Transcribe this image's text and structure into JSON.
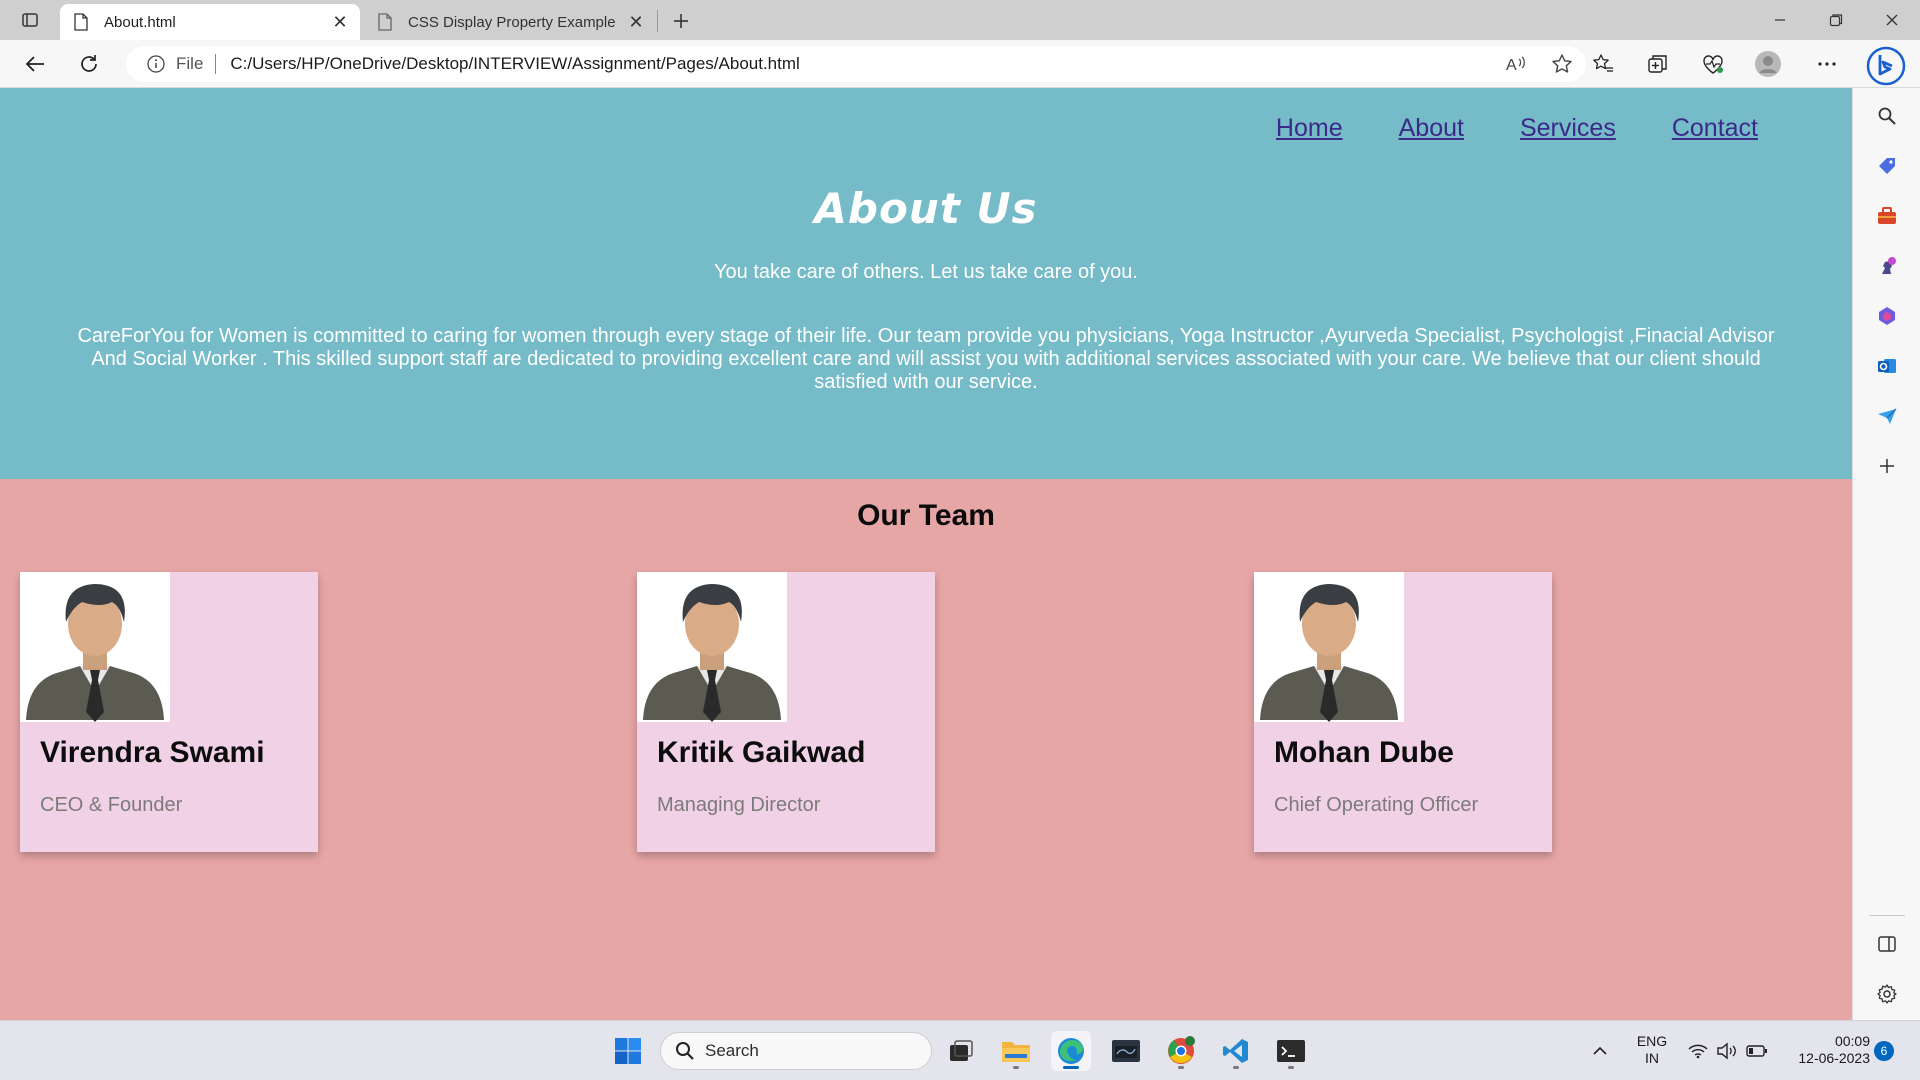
{
  "browser": {
    "tabs": [
      {
        "title": "About.html",
        "active": true
      },
      {
        "title": "CSS Display Property Example",
        "active": false
      }
    ],
    "address": {
      "scheme_label": "File",
      "url": "C:/Users/HP/OneDrive/Desktop/INTERVIEW/Assignment/Pages/About.html"
    }
  },
  "page": {
    "nav": [
      "Home",
      "About",
      "Services",
      "Contact"
    ],
    "title": "About Us",
    "tagline": "You take care of others. Let us take care of you.",
    "description": "CareForYou for Women is committed to caring for women through every stage of their life. Our team provide you physicians, Yoga Instructor ,Ayurveda Specialist, Psychologist ,Finacial Advisor And Social Worker . This skilled support staff are dedicated to providing excellent care and will assist you with additional services associated with your care. We believe that our client should satisfied with our service.",
    "team_heading": "Our Team",
    "team": [
      {
        "name": "Virendra Swami",
        "role": "CEO & Founder"
      },
      {
        "name": "Kritik Gaikwad",
        "role": "Managing Director"
      },
      {
        "name": "Mohan Dube",
        "role": "Chief Operating Officer"
      }
    ]
  },
  "taskbar": {
    "search_label": "Search",
    "language": {
      "line1": "ENG",
      "line2": "IN"
    },
    "time": "00:09",
    "date": "12-06-2023",
    "notification_count": "6"
  },
  "colors": {
    "hero_bg": "#76bbc8",
    "team_bg": "#e7a6a6",
    "card_bg": "#f1d1e6",
    "nav_link": "#3b2a8a"
  }
}
